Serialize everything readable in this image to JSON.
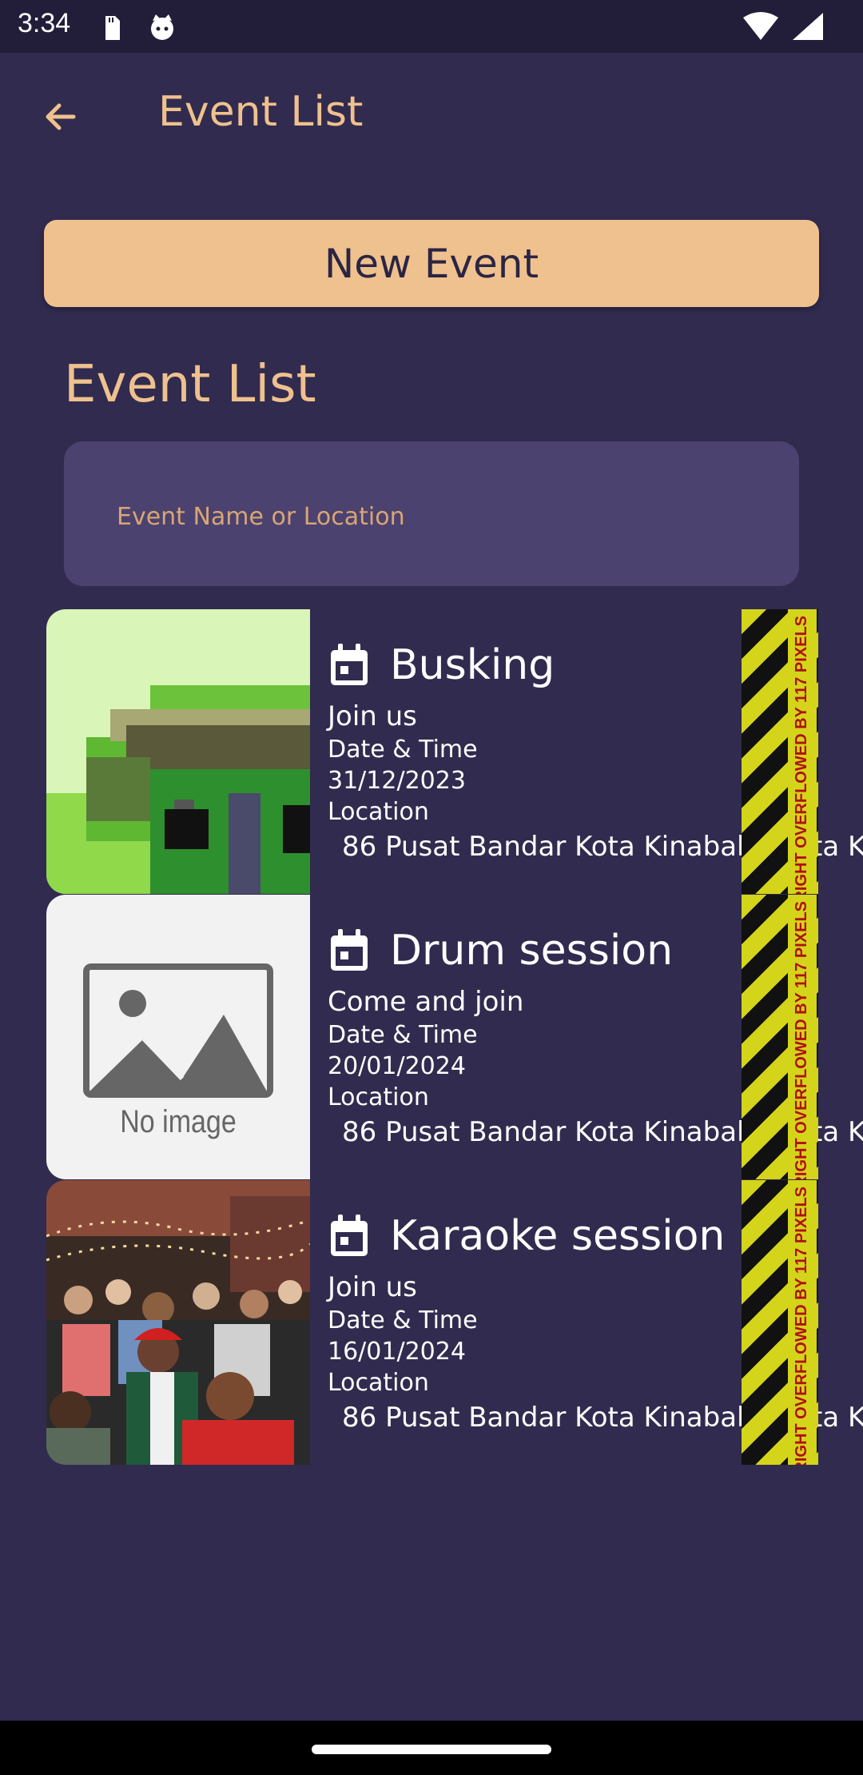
{
  "status_bar": {
    "time": "3:34"
  },
  "app_bar": {
    "title": "Event List"
  },
  "new_event_button": {
    "label": "New Event"
  },
  "section": {
    "title": "Event List"
  },
  "search": {
    "placeholder": "Event Name or Location",
    "value": ""
  },
  "events": [
    {
      "title": "Busking",
      "description": "Join us",
      "date_label": "Date & Time",
      "date": "31/12/2023",
      "location_label": "Location",
      "location": "86 Pusat Bandar Kota Kinabalu, Kota K",
      "image": "pixel-art-house"
    },
    {
      "title": "Drum session",
      "description": "Come and join",
      "date_label": "Date & Time",
      "date": "20/01/2024",
      "location_label": "Location",
      "location": "86 Pusat Bandar Kota Kinabalu, Kota K",
      "image": "no-image-placeholder",
      "image_text": "No image"
    },
    {
      "title": "Karaoke session",
      "description": "Join us",
      "date_label": "Date & Time",
      "date": "16/01/2024",
      "location_label": "Location",
      "location": "86 Pusat Bandar Kota Kinabalu, Kota K",
      "image": "crowd-photo"
    }
  ],
  "overflow_warning": "RIGHT OVERFLOWED BY 117 PIXELS",
  "colors": {
    "background": "#312b4f",
    "accent": "#efc18e",
    "search_bg": "#4b4270",
    "status_bar": "#221d38"
  },
  "icons": {
    "back": "arrow-left-icon",
    "event": "calendar-icon",
    "wifi": "wifi-icon",
    "signal": "signal-icon",
    "sd_card": "sd-card-icon",
    "notification": "cat-face-icon"
  }
}
